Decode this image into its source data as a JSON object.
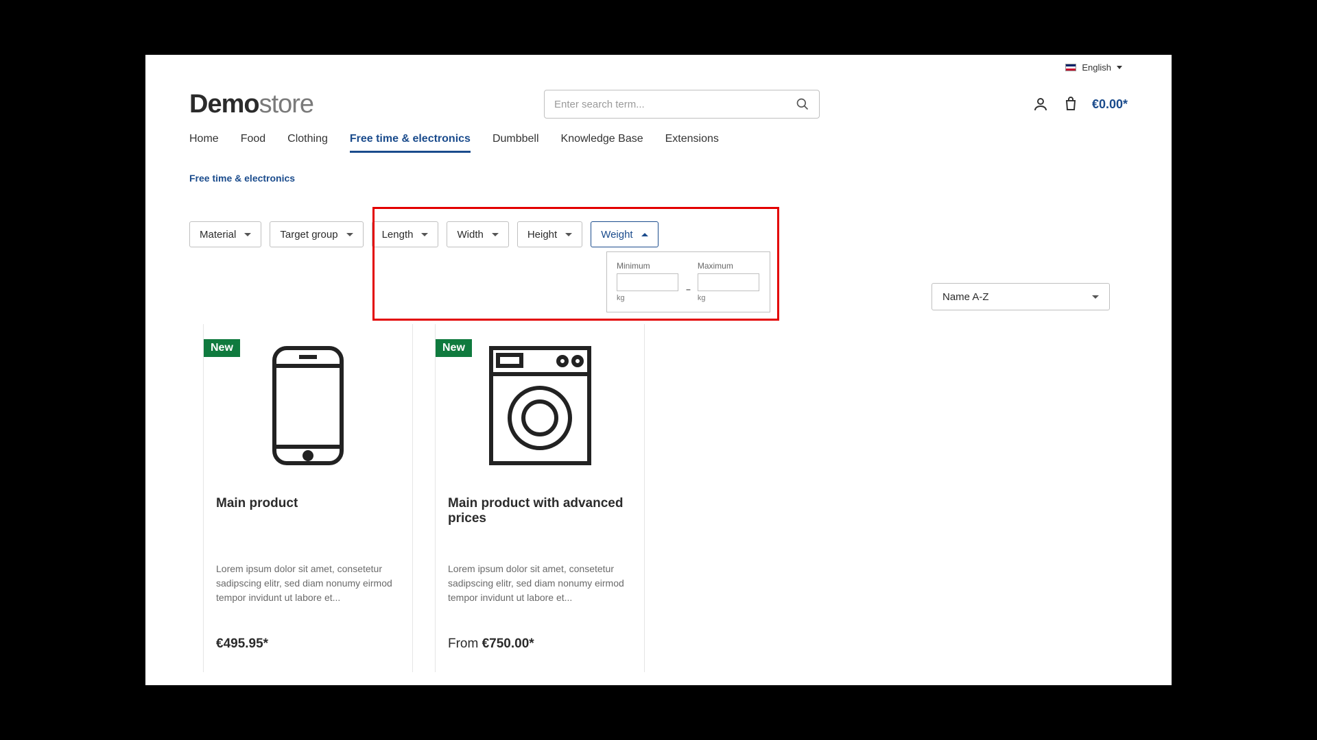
{
  "lang": {
    "label": "English"
  },
  "logo": {
    "bold": "Demo",
    "rest": "store"
  },
  "search": {
    "placeholder": "Enter search term..."
  },
  "cart": {
    "total": "€0.00*"
  },
  "nav": [
    {
      "label": "Home"
    },
    {
      "label": "Food"
    },
    {
      "label": "Clothing"
    },
    {
      "label": "Free time & electronics",
      "active": true
    },
    {
      "label": "Dumbbell"
    },
    {
      "label": "Knowledge Base"
    },
    {
      "label": "Extensions"
    }
  ],
  "breadcrumb": "Free time & electronics",
  "filters": {
    "material": "Material",
    "target_group": "Target group",
    "length": "Length",
    "width": "Width",
    "height": "Height",
    "weight": "Weight"
  },
  "weight_panel": {
    "min_label": "Minimum",
    "max_label": "Maximum",
    "unit": "kg",
    "dash": "–"
  },
  "sort": {
    "selected": "Name A-Z"
  },
  "products": [
    {
      "badge": "New",
      "title": "Main product",
      "desc": "Lorem ipsum dolor sit amet, consetetur sadipscing elitr, sed diam nonumy eirmod tempor invidunt ut labore et...",
      "price_prefix": "",
      "price": "€495.95*"
    },
    {
      "badge": "New",
      "title": "Main product with advanced prices",
      "desc": "Lorem ipsum dolor sit amet, consetetur sadipscing elitr, sed diam nonumy eirmod tempor invidunt ut labore et...",
      "price_prefix": "From ",
      "price": "€750.00*"
    }
  ]
}
